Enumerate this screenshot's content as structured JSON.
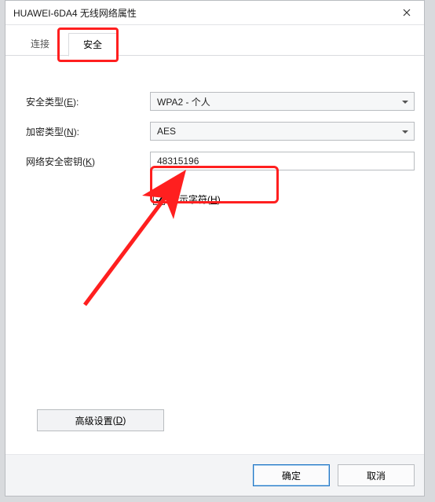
{
  "title": "HUAWEI-6DA4 无线网络属性",
  "tabs": {
    "connection": "连接",
    "security": "安全"
  },
  "labels": {
    "security_type": "安全类型",
    "security_type_key": "E",
    "encryption_type": "加密类型",
    "encryption_type_key": "N",
    "security_key": "网络安全密钥",
    "security_key_key": "K",
    "show_chars": "显示字符",
    "show_chars_key": "H",
    "advanced": "高级设置",
    "advanced_key": "D"
  },
  "values": {
    "security_type": "WPA2 - 个人",
    "encryption_type": "AES",
    "security_key": "48315196",
    "show_chars_checked": true
  },
  "buttons": {
    "ok": "确定",
    "cancel": "取消"
  },
  "annotation": {
    "color": "#ff1f1f"
  }
}
